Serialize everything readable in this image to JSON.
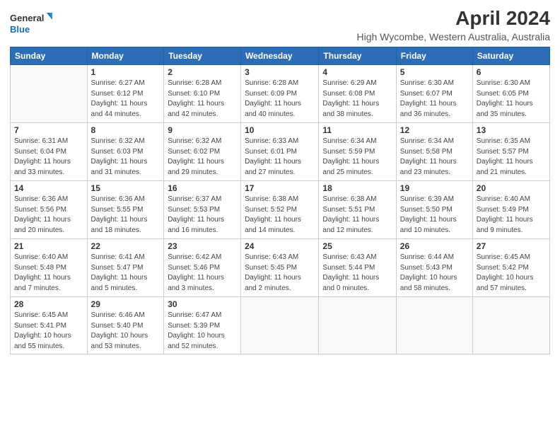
{
  "header": {
    "logo_line1": "General",
    "logo_line2": "Blue",
    "main_title": "April 2024",
    "subtitle": "High Wycombe, Western Australia, Australia"
  },
  "calendar": {
    "days_of_week": [
      "Sunday",
      "Monday",
      "Tuesday",
      "Wednesday",
      "Thursday",
      "Friday",
      "Saturday"
    ],
    "weeks": [
      [
        {
          "num": "",
          "info": ""
        },
        {
          "num": "1",
          "info": "Sunrise: 6:27 AM\nSunset: 6:12 PM\nDaylight: 11 hours\nand 44 minutes."
        },
        {
          "num": "2",
          "info": "Sunrise: 6:28 AM\nSunset: 6:10 PM\nDaylight: 11 hours\nand 42 minutes."
        },
        {
          "num": "3",
          "info": "Sunrise: 6:28 AM\nSunset: 6:09 PM\nDaylight: 11 hours\nand 40 minutes."
        },
        {
          "num": "4",
          "info": "Sunrise: 6:29 AM\nSunset: 6:08 PM\nDaylight: 11 hours\nand 38 minutes."
        },
        {
          "num": "5",
          "info": "Sunrise: 6:30 AM\nSunset: 6:07 PM\nDaylight: 11 hours\nand 36 minutes."
        },
        {
          "num": "6",
          "info": "Sunrise: 6:30 AM\nSunset: 6:05 PM\nDaylight: 11 hours\nand 35 minutes."
        }
      ],
      [
        {
          "num": "7",
          "info": "Sunrise: 6:31 AM\nSunset: 6:04 PM\nDaylight: 11 hours\nand 33 minutes."
        },
        {
          "num": "8",
          "info": "Sunrise: 6:32 AM\nSunset: 6:03 PM\nDaylight: 11 hours\nand 31 minutes."
        },
        {
          "num": "9",
          "info": "Sunrise: 6:32 AM\nSunset: 6:02 PM\nDaylight: 11 hours\nand 29 minutes."
        },
        {
          "num": "10",
          "info": "Sunrise: 6:33 AM\nSunset: 6:01 PM\nDaylight: 11 hours\nand 27 minutes."
        },
        {
          "num": "11",
          "info": "Sunrise: 6:34 AM\nSunset: 5:59 PM\nDaylight: 11 hours\nand 25 minutes."
        },
        {
          "num": "12",
          "info": "Sunrise: 6:34 AM\nSunset: 5:58 PM\nDaylight: 11 hours\nand 23 minutes."
        },
        {
          "num": "13",
          "info": "Sunrise: 6:35 AM\nSunset: 5:57 PM\nDaylight: 11 hours\nand 21 minutes."
        }
      ],
      [
        {
          "num": "14",
          "info": "Sunrise: 6:36 AM\nSunset: 5:56 PM\nDaylight: 11 hours\nand 20 minutes."
        },
        {
          "num": "15",
          "info": "Sunrise: 6:36 AM\nSunset: 5:55 PM\nDaylight: 11 hours\nand 18 minutes."
        },
        {
          "num": "16",
          "info": "Sunrise: 6:37 AM\nSunset: 5:53 PM\nDaylight: 11 hours\nand 16 minutes."
        },
        {
          "num": "17",
          "info": "Sunrise: 6:38 AM\nSunset: 5:52 PM\nDaylight: 11 hours\nand 14 minutes."
        },
        {
          "num": "18",
          "info": "Sunrise: 6:38 AM\nSunset: 5:51 PM\nDaylight: 11 hours\nand 12 minutes."
        },
        {
          "num": "19",
          "info": "Sunrise: 6:39 AM\nSunset: 5:50 PM\nDaylight: 11 hours\nand 10 minutes."
        },
        {
          "num": "20",
          "info": "Sunrise: 6:40 AM\nSunset: 5:49 PM\nDaylight: 11 hours\nand 9 minutes."
        }
      ],
      [
        {
          "num": "21",
          "info": "Sunrise: 6:40 AM\nSunset: 5:48 PM\nDaylight: 11 hours\nand 7 minutes."
        },
        {
          "num": "22",
          "info": "Sunrise: 6:41 AM\nSunset: 5:47 PM\nDaylight: 11 hours\nand 5 minutes."
        },
        {
          "num": "23",
          "info": "Sunrise: 6:42 AM\nSunset: 5:46 PM\nDaylight: 11 hours\nand 3 minutes."
        },
        {
          "num": "24",
          "info": "Sunrise: 6:43 AM\nSunset: 5:45 PM\nDaylight: 11 hours\nand 2 minutes."
        },
        {
          "num": "25",
          "info": "Sunrise: 6:43 AM\nSunset: 5:44 PM\nDaylight: 11 hours\nand 0 minutes."
        },
        {
          "num": "26",
          "info": "Sunrise: 6:44 AM\nSunset: 5:43 PM\nDaylight: 10 hours\nand 58 minutes."
        },
        {
          "num": "27",
          "info": "Sunrise: 6:45 AM\nSunset: 5:42 PM\nDaylight: 10 hours\nand 57 minutes."
        }
      ],
      [
        {
          "num": "28",
          "info": "Sunrise: 6:45 AM\nSunset: 5:41 PM\nDaylight: 10 hours\nand 55 minutes."
        },
        {
          "num": "29",
          "info": "Sunrise: 6:46 AM\nSunset: 5:40 PM\nDaylight: 10 hours\nand 53 minutes."
        },
        {
          "num": "30",
          "info": "Sunrise: 6:47 AM\nSunset: 5:39 PM\nDaylight: 10 hours\nand 52 minutes."
        },
        {
          "num": "",
          "info": ""
        },
        {
          "num": "",
          "info": ""
        },
        {
          "num": "",
          "info": ""
        },
        {
          "num": "",
          "info": ""
        }
      ]
    ]
  }
}
